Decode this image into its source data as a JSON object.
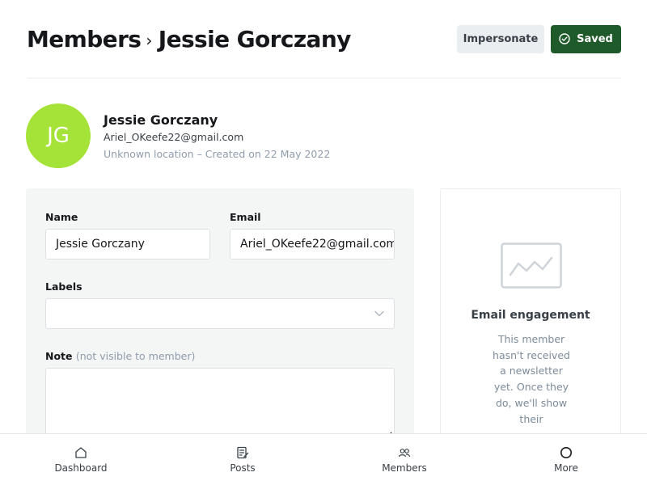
{
  "header": {
    "breadcrumb_parent": "Members",
    "breadcrumb_separator": "›",
    "title": "Jessie Gorczany",
    "impersonate_label": "Impersonate",
    "saved_label": "Saved"
  },
  "member": {
    "initials": "JG",
    "name": "Jessie Gorczany",
    "email": "Ariel_OKeefe22@gmail.com",
    "meta": "Unknown location – Created on 22 May 2022",
    "avatar_color": "#a6e339"
  },
  "form": {
    "name_label": "Name",
    "name_value": "Jessie Gorczany",
    "email_label": "Email",
    "email_value": "Ariel_OKeefe22@gmail.com",
    "labels_label": "Labels",
    "labels_value": "",
    "note_label": "Note",
    "note_hint": "(not visible to member)",
    "note_value": ""
  },
  "engagement": {
    "title": "Email engagement",
    "text": "This member hasn't received a newsletter yet. Once they do, we'll show their"
  },
  "nav": {
    "items": [
      {
        "label": "Dashboard",
        "icon": "home-icon"
      },
      {
        "label": "Posts",
        "icon": "posts-icon"
      },
      {
        "label": "Members",
        "icon": "members-icon"
      },
      {
        "label": "More",
        "icon": "more-icon"
      }
    ]
  },
  "colors": {
    "saved_button": "#1e5a2a",
    "panel_background": "#f4f5f5"
  }
}
